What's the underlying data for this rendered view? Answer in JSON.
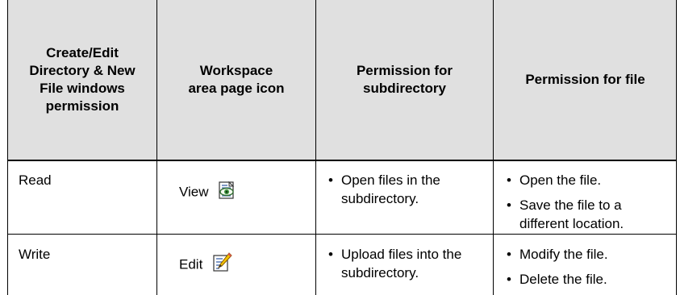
{
  "headers": [
    "Create/Edit Directory & New File windows permission",
    "Workspace area page icon",
    "Permission for subdirectory",
    "Permission for file"
  ],
  "rows": [
    {
      "permission": "Read",
      "icon_label": "View",
      "icon": "view-page-eye-icon",
      "subdirectory": [
        "Open files in the subdirectory."
      ],
      "file": [
        "Open the file.",
        "Save the file to a different location."
      ]
    },
    {
      "permission": "Write",
      "icon_label": "Edit",
      "icon": "edit-page-pencil-icon",
      "subdirectory": [
        "Upload files into the subdirectory."
      ],
      "file": [
        "Modify the file.",
        "Delete the file."
      ]
    }
  ]
}
